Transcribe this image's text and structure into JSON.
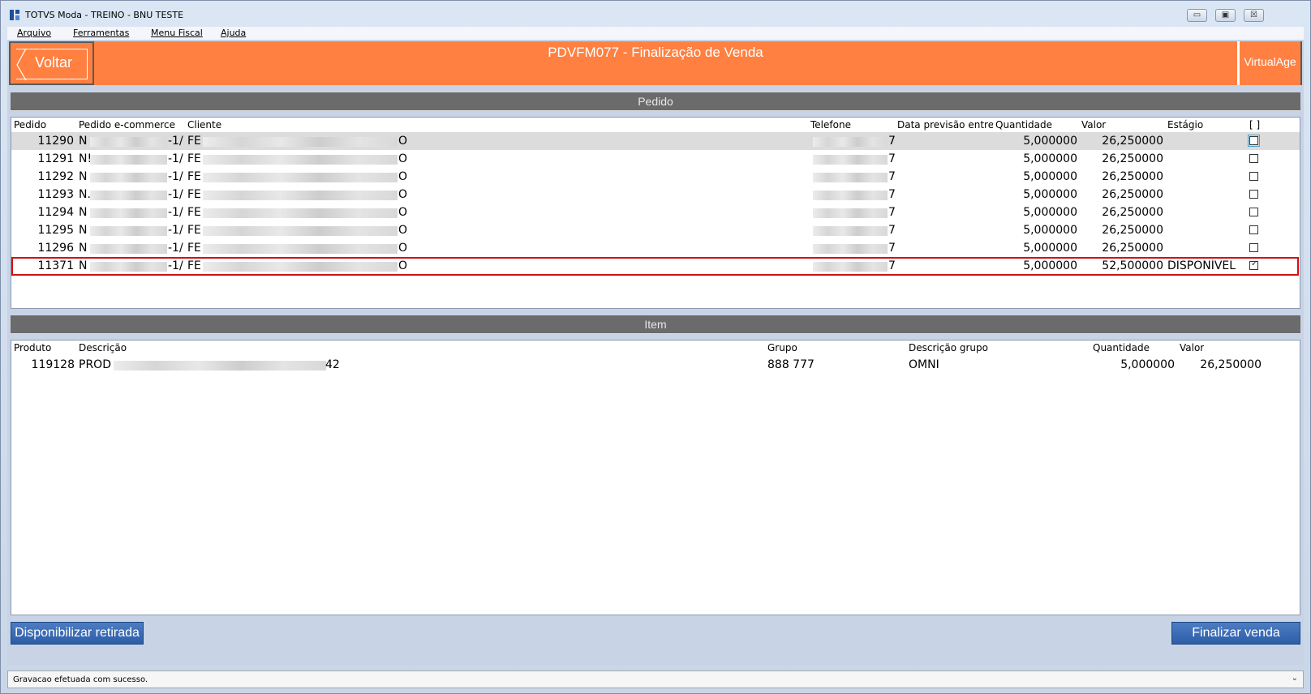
{
  "window": {
    "title": "TOTVS Moda - TREINO - BNU TESTE",
    "controls": {
      "minimize": "▭",
      "maximize": "▣",
      "close": "☒"
    }
  },
  "menu": [
    "Arquivo",
    "Ferramentas",
    "Menu Fiscal",
    "Ajuda"
  ],
  "header": {
    "back_label": "Voltar",
    "title": "PDVFM077 - Finalização de Venda",
    "brand_label": "VirtualAge",
    "color": "#ff8040"
  },
  "pedido": {
    "section_label": "Pedido",
    "columns": [
      "Pedido",
      "Pedido e-commerce",
      "Cliente",
      "Telefone",
      "Data previsão entre",
      "Quantidade",
      "Valor",
      "Estágio",
      "[ ]"
    ],
    "rows": [
      {
        "pedido": "11290",
        "ecom_start": "N",
        "ecom_end": "-1/",
        "cliente_start": "FE",
        "cliente_end": "O",
        "tel_end": "7",
        "quantidade": "5,000000",
        "valor": "26,250000",
        "estagio": "",
        "checked": false
      },
      {
        "pedido": "11291",
        "ecom_start": "N!",
        "ecom_end": "-1/",
        "cliente_start": "FE",
        "cliente_end": "O",
        "tel_end": "7",
        "quantidade": "5,000000",
        "valor": "26,250000",
        "estagio": "",
        "checked": false
      },
      {
        "pedido": "11292",
        "ecom_start": "N",
        "ecom_end": "-1/",
        "cliente_start": "FE",
        "cliente_end": "O",
        "tel_end": "7",
        "quantidade": "5,000000",
        "valor": "26,250000",
        "estagio": "",
        "checked": false
      },
      {
        "pedido": "11293",
        "ecom_start": "N.",
        "ecom_end": "-1/",
        "cliente_start": "FE",
        "cliente_end": "O",
        "tel_end": "7",
        "quantidade": "5,000000",
        "valor": "26,250000",
        "estagio": "",
        "checked": false
      },
      {
        "pedido": "11294",
        "ecom_start": "N",
        "ecom_end": "-1/",
        "cliente_start": "FE",
        "cliente_end": "O",
        "tel_end": "7",
        "quantidade": "5,000000",
        "valor": "26,250000",
        "estagio": "",
        "checked": false
      },
      {
        "pedido": "11295",
        "ecom_start": "N",
        "ecom_end": "-1/",
        "cliente_start": "FE",
        "cliente_end": "O",
        "tel_end": "7",
        "quantidade": "5,000000",
        "valor": "26,250000",
        "estagio": "",
        "checked": false
      },
      {
        "pedido": "11296",
        "ecom_start": "N",
        "ecom_end": "-1/",
        "cliente_start": "FE",
        "cliente_end": "O",
        "tel_end": "7",
        "quantidade": "5,000000",
        "valor": "26,250000",
        "estagio": "",
        "checked": false
      },
      {
        "pedido": "11371",
        "ecom_start": "N",
        "ecom_end": "-1/",
        "cliente_start": "FE",
        "cliente_end": "O",
        "tel_end": "7",
        "quantidade": "5,000000",
        "valor": "52,500000",
        "estagio": "DISPONÍVEL",
        "checked": true
      }
    ]
  },
  "item": {
    "section_label": "Item",
    "columns": [
      "Produto",
      "Descrição",
      "Grupo",
      "Descrição grupo",
      "Quantidade",
      "Valor"
    ],
    "rows": [
      {
        "produto": "119128",
        "descricao_start": "PROD",
        "descricao_end": "42",
        "grupo": "888 777",
        "descricao_grupo": "OMNI",
        "quantidade": "5,000000",
        "valor": "26,250000"
      }
    ]
  },
  "buttons": {
    "disponibilizar": "Disponibilizar retirada",
    "finalizar": "Finalizar venda"
  },
  "status": {
    "text": "Gravacao efetuada com sucesso."
  }
}
